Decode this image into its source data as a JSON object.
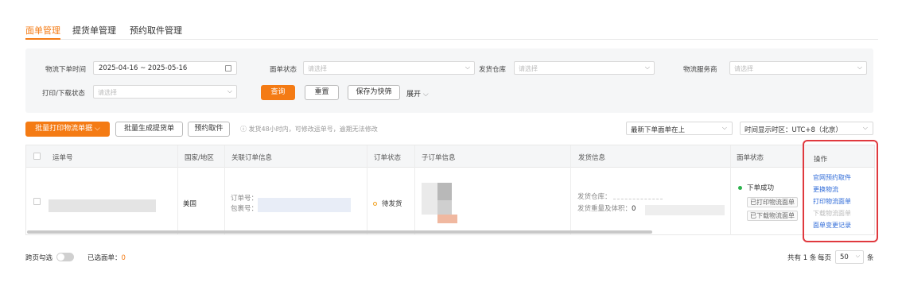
{
  "tabs": [
    {
      "label": "面单管理",
      "active": true
    },
    {
      "label": "提货单管理",
      "active": false
    },
    {
      "label": "预约取件管理",
      "active": false
    }
  ],
  "filters": {
    "order_time_label": "物流下单时间",
    "order_time_value": "2025-04-16 ~ 2025-05-16",
    "status_label": "面单状态",
    "status_placeholder": "请选择",
    "warehouse_label": "发货仓库",
    "warehouse_placeholder": "请选择",
    "service_label": "物流服务商",
    "service_placeholder": "请选择",
    "print_label": "打印/下载状态",
    "print_placeholder": "请选择",
    "query_button": "查询",
    "reset_button": "重置",
    "save_shortcut_button": "保存为快筛",
    "expand_label": "展开"
  },
  "toolbar": {
    "batch_print_button": "批量打印物流单据",
    "batch_pickup_button": "批量生成提货单",
    "schedule_pickup_button": "预约取件",
    "hint": "发货48小时内，可修改运单号，逾期无法修改",
    "sort_value": "最新下单面单在上",
    "timezone_value": "时间显示时区：UTC+8（北京）"
  },
  "table": {
    "headers": {
      "tracking_no": "运单号",
      "country": "国家/地区",
      "related_order": "关联订单信息",
      "order_status": "订单状态",
      "sub_order": "子订单信息",
      "shipping_info": "发货信息",
      "label_status": "面单状态",
      "actions": "操作"
    },
    "row": {
      "country": "美国",
      "order_no_label": "订单号：",
      "package_no_label": "包裹号：",
      "order_status": "待发货",
      "ship_warehouse_label": "发货仓库：",
      "ship_weight_label": "发货重量及体积：",
      "ship_weight_value": "0",
      "label_status": "下单成功",
      "printed_tag": "已打印物流面单",
      "downloaded_tag": "已下载物流面单",
      "actions": [
        {
          "label": "官网预约取件",
          "enabled": true
        },
        {
          "label": "更换物流",
          "enabled": true
        },
        {
          "label": "打印物流面单",
          "enabled": true
        },
        {
          "label": "下载物流面单",
          "enabled": false
        },
        {
          "label": "面单变更记录",
          "enabled": true
        }
      ]
    }
  },
  "footer": {
    "cross_page_label": "跨页勾选",
    "selected_label": "已选面单：",
    "selected_count": "0",
    "total_prefix": "共有",
    "total_value": "1",
    "total_suffix": "条",
    "per_page_prefix": "每页",
    "per_page_value": "50",
    "per_page_suffix": "条"
  },
  "colors": {
    "accent": "#f47b14",
    "link": "#2f6bd8",
    "highlight_border": "#e0393e",
    "success": "#2bb24c"
  }
}
